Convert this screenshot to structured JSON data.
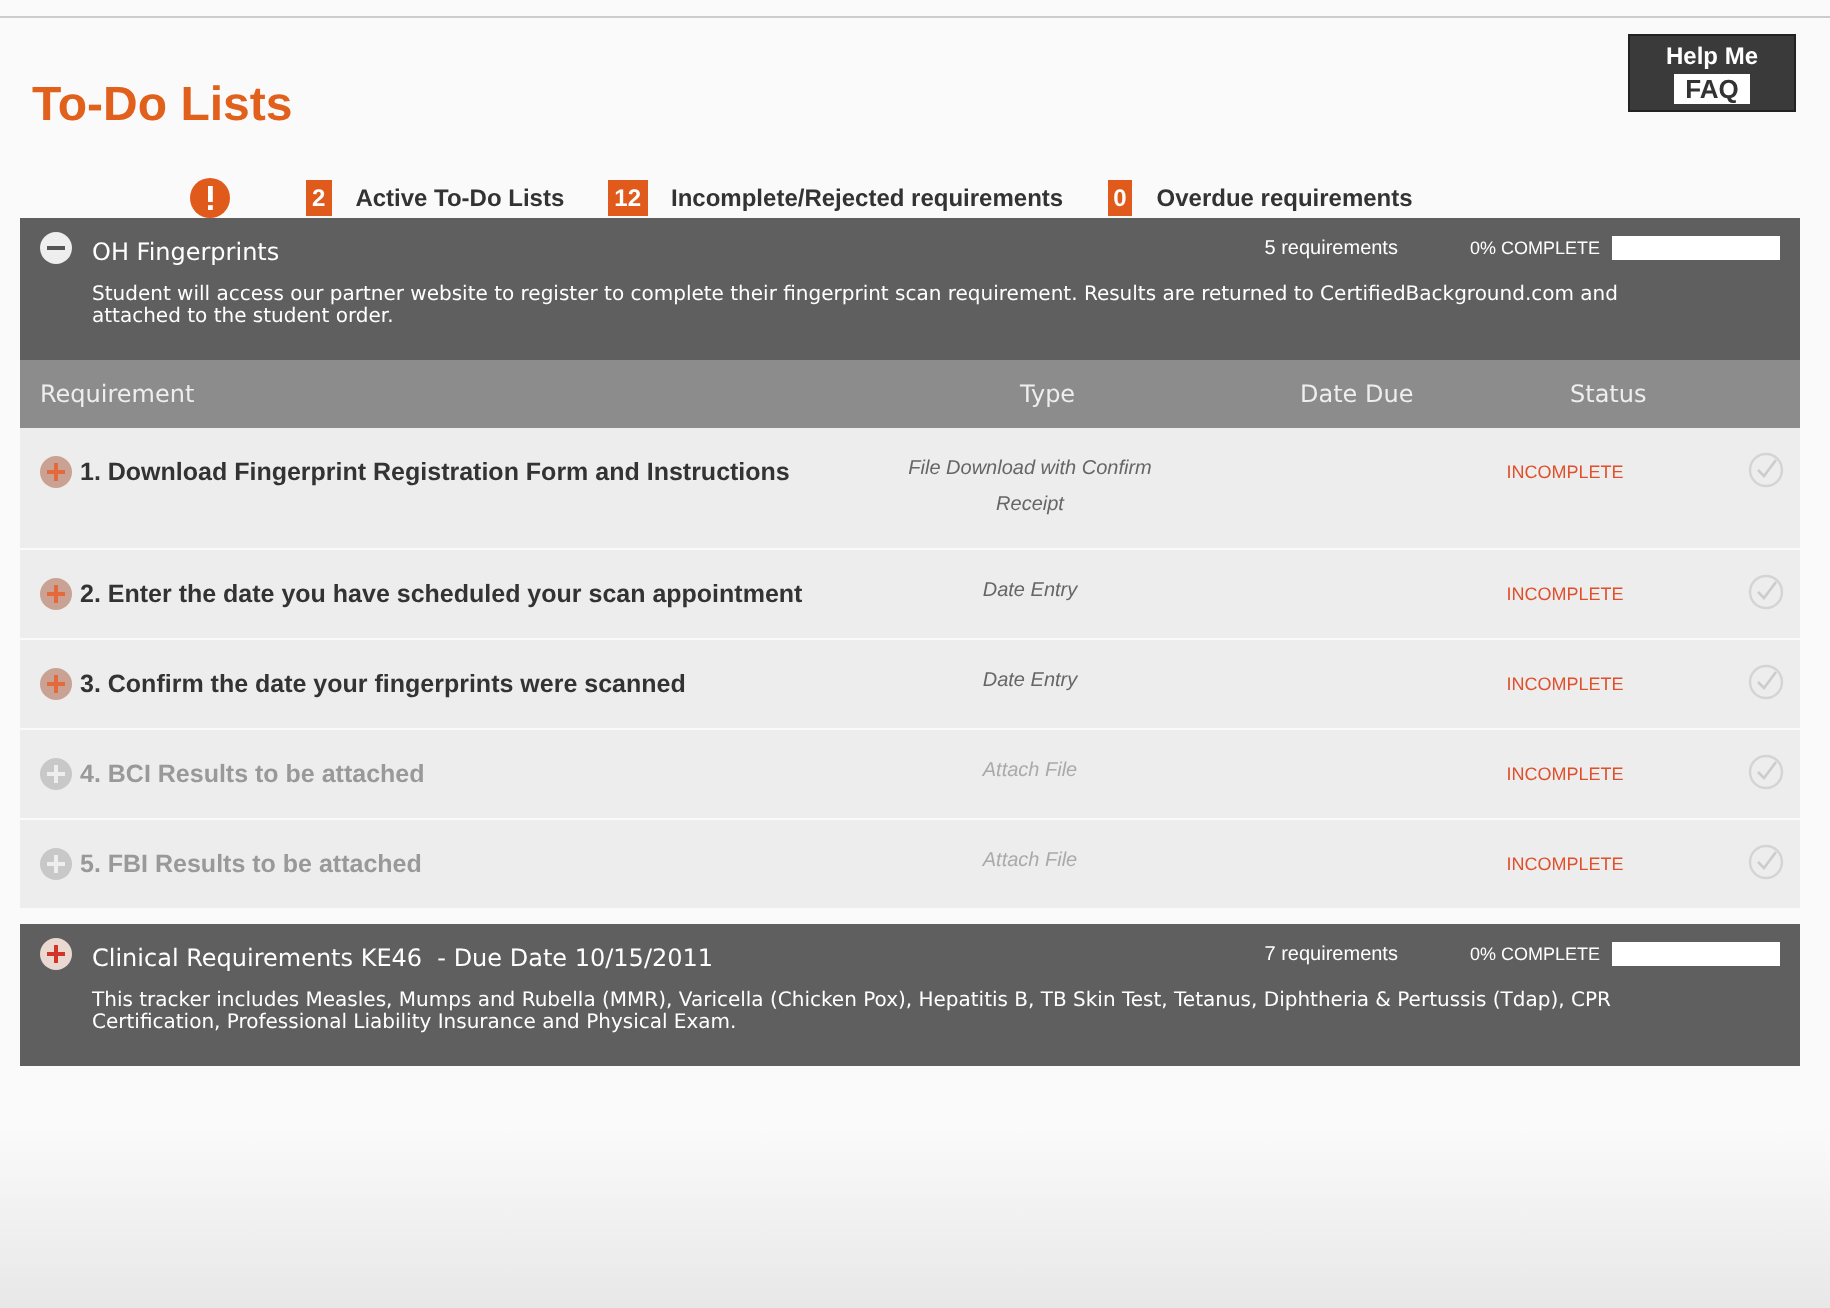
{
  "header": {
    "title": "To-Do Lists",
    "help": {
      "line1": "Help Me",
      "line2": "FAQ"
    }
  },
  "stats": [
    {
      "count": "2",
      "label": "Active To-Do Lists"
    },
    {
      "count": "12",
      "label": "Incomplete/Rejected requirements"
    },
    {
      "count": "0",
      "label": "Overdue requirements"
    }
  ],
  "lists": [
    {
      "title": "OH Fingerprints",
      "expanded": true,
      "count": "5 requirements",
      "complete": "0% COMPLETE",
      "level": 0,
      "description": "Student will access our partner website to register to complete their fingerprint scan requirement. Results are returned to CertifiedBackground.com and attached to the student order.",
      "columns": [
        "Requirement",
        "Type",
        "Date Due",
        "Status"
      ],
      "rows": [
        {
          "name": "1. Download Fingerprint Registration Form and Instructions",
          "type": "File Download with Confirm Receipt",
          "status": "INCOMPLETE",
          "disabled": false
        },
        {
          "name": "2. Enter the date you have scheduled your scan appointment",
          "type": "Date Entry",
          "status": "INCOMPLETE",
          "disabled": false
        },
        {
          "name": "3. Confirm the date your fingerprints were scanned",
          "type": "Date Entry",
          "status": "INCOMPLETE",
          "disabled": false
        },
        {
          "name": "4. BCI Results to be attached",
          "type": "Attach File",
          "status": "INCOMPLETE",
          "disabled": true
        },
        {
          "name": "5. FBI Results to be attached",
          "type": "Attach File",
          "status": "INCOMPLETE",
          "disabled": true
        }
      ]
    },
    {
      "title": "Clinical Requirements KE46  - Due Date 10/15/2011",
      "expanded": false,
      "count": "7 requirements",
      "complete": "0% COMPLETE",
      "level": 0,
      "description": "This tracker includes Measles, Mumps and Rubella (MMR), Varicella (Chicken Pox), Hepatitis B, TB Skin Test, Tetanus, Diphtheria & Pertussis (Tdap), CPR Certification, Professional Liability Insurance and Physical Exam."
    }
  ]
}
